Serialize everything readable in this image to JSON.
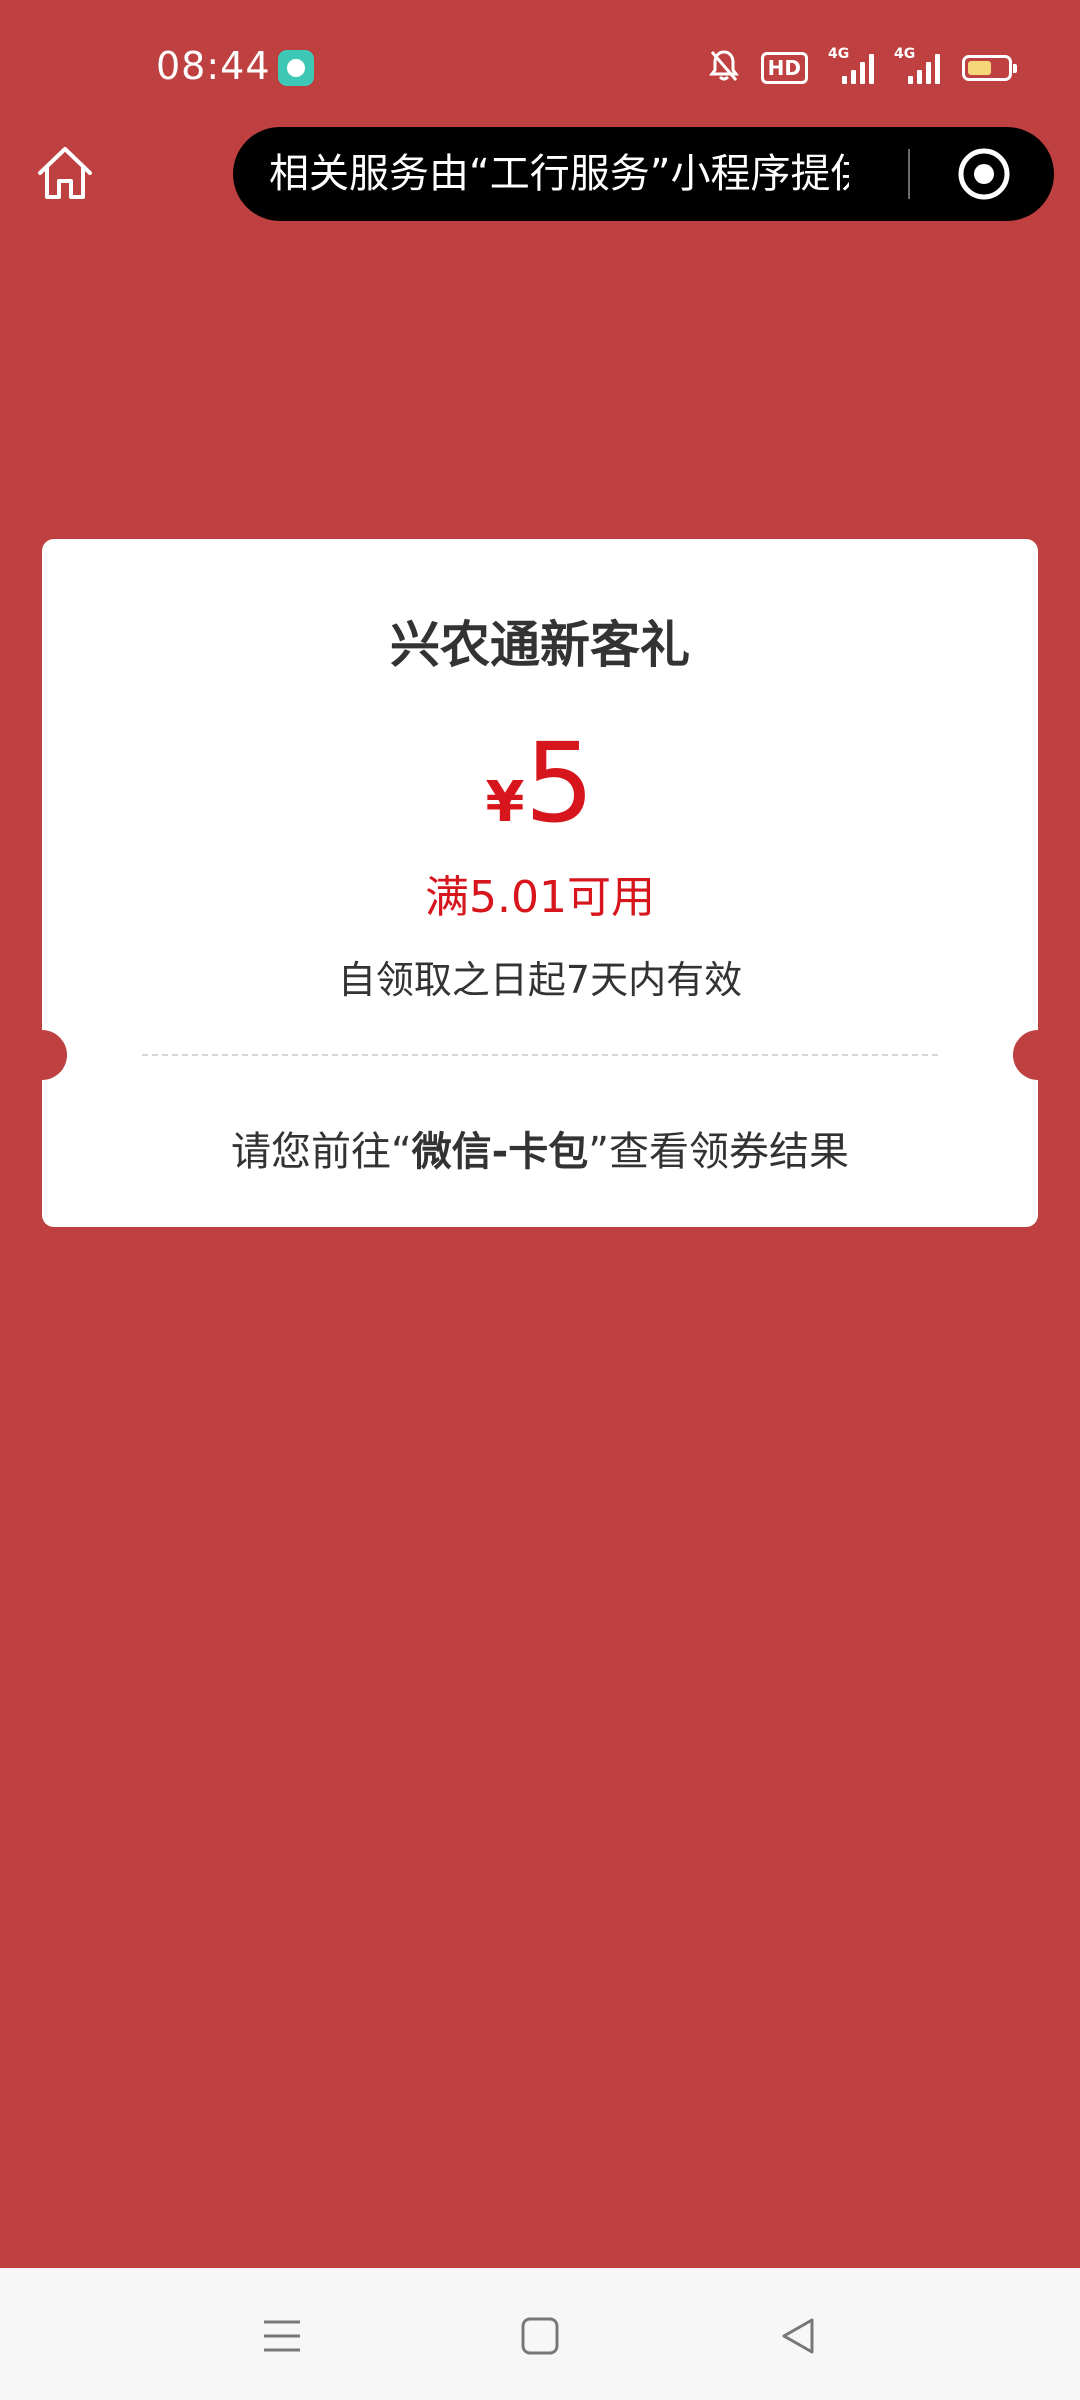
{
  "status_bar": {
    "time": "08:44",
    "hd_label": "HD",
    "signal_1_label": "4G",
    "signal_2_label": "4G",
    "battery_level": 0.6,
    "icons": [
      "mute-bell-icon",
      "hd-icon",
      "signal-icon",
      "signal-icon",
      "battery-icon"
    ]
  },
  "header": {
    "home_icon": "home-icon",
    "capsule_text": "相关服务由“工行服务”小程序提供",
    "capsule_icon": "target-icon"
  },
  "coupon": {
    "title": "兴农通新客礼",
    "currency": "¥",
    "amount": "5",
    "condition": "满5.01可用",
    "validity": "自领取之日起7天内有效",
    "notice_prefix": "请您前往",
    "notice_quote_open": "“",
    "notice_emphasis": "微信-卡包",
    "notice_quote_close": "”",
    "notice_suffix": "查看领券结果"
  },
  "colors": {
    "background": "#bf4040",
    "accent_red": "#d6161c",
    "card": "#ffffff",
    "capsule": "#000000"
  },
  "nav_bar": {
    "icons": [
      "menu-icon",
      "square-home-icon",
      "back-triangle-icon"
    ]
  }
}
